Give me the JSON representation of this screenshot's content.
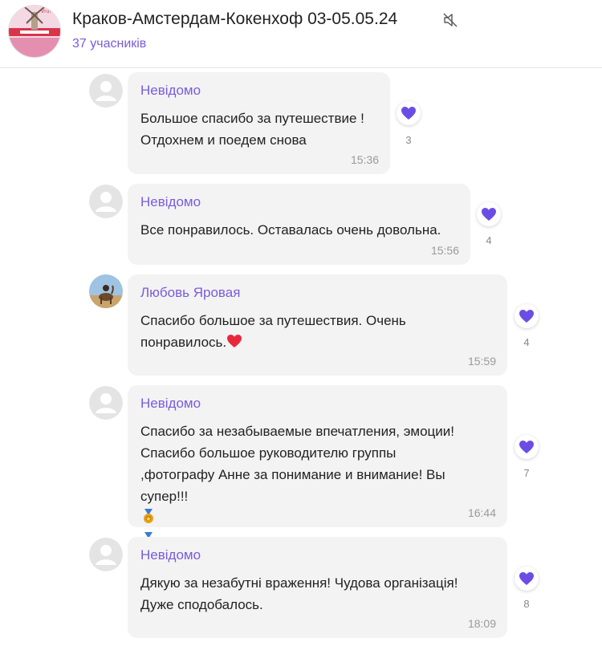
{
  "header": {
    "title": "Краков-Амстердам-Кокенхоф 03-05.05.24",
    "members": "37 учасників",
    "avatar_icon": "group-avatar-windmill"
  },
  "colors": {
    "accent": "#7a5cdb",
    "bubble": "#f3f3f3",
    "heart": "#6b4de6"
  },
  "messages": [
    {
      "sender": "Невідомо",
      "text": "Большое спасибо за путешествие !\nОтдохнем и поедем снова",
      "time": "15:36",
      "reaction_icon": "purple-heart-icon",
      "reaction_count": "3"
    },
    {
      "sender": "Невідомо",
      "text": "Все понравилось. Оставалась очень довольна.",
      "time": "15:56",
      "reaction_icon": "purple-heart-icon",
      "reaction_count": "4"
    },
    {
      "sender": "Любовь Яровая",
      "text": "Спасибо большое за путешествия. Очень\nпонравилось.",
      "trailing_emoji": "red-heart-icon",
      "time": "15:59",
      "reaction_icon": "purple-heart-icon",
      "reaction_count": "4"
    },
    {
      "sender": "Невідомо",
      "text": "Спасибо за незабываемые впечатления, эмоции!\nСпасибо большое руководителю группы\n,фотографу Анне за понимание и внимание! Вы\nсупер!!!",
      "trailing_emoji": "medal-icon x3",
      "time": "16:44",
      "reaction_icon": "purple-heart-icon",
      "reaction_count": "7"
    },
    {
      "sender": "Невідомо",
      "text": "Дякую за незабутні враження! Чудова організація!\nДуже сподобалось.",
      "time": "18:09",
      "reaction_icon": "purple-heart-icon",
      "reaction_count": "8"
    }
  ]
}
